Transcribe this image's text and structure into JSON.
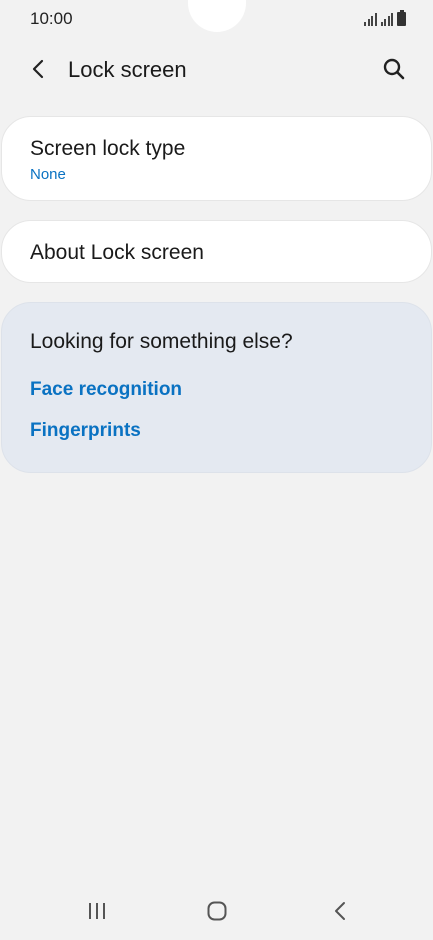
{
  "status": {
    "time": "10:00"
  },
  "header": {
    "title": "Lock screen",
    "back_icon": "chevron-left-icon",
    "search_icon": "search-icon"
  },
  "settings": {
    "screen_lock_type": {
      "title": "Screen lock type",
      "value": "None"
    },
    "about": {
      "title": "About Lock screen"
    }
  },
  "suggestions": {
    "heading": "Looking for something else?",
    "links": [
      "Face recognition",
      "Fingerprints"
    ]
  },
  "colors": {
    "accent": "#0a72c2",
    "background": "#f2f2f2",
    "suggestion_card": "#e4e9f1"
  },
  "navbar": {
    "icons": [
      "recents-icon",
      "home-icon",
      "back-icon"
    ]
  }
}
